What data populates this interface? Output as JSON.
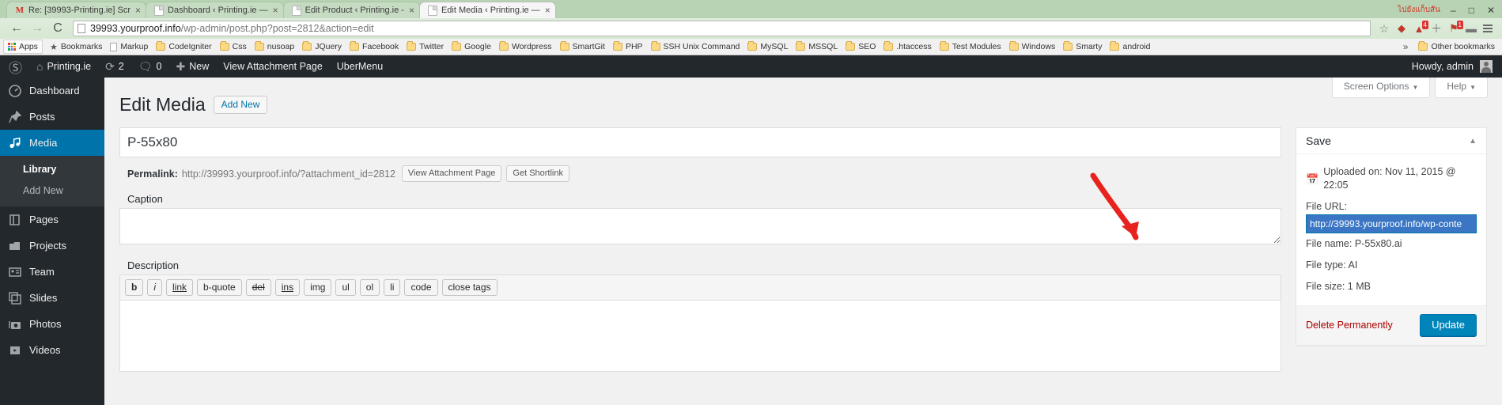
{
  "browser": {
    "tabs": [
      {
        "title": "Re: [39993-Printing.ie] Scr",
        "favicon": "gmail-icon",
        "active": false
      },
      {
        "title": "Dashboard ‹ Printing.ie —",
        "favicon": "page-icon",
        "active": false
      },
      {
        "title": "Edit Product ‹ Printing.ie -",
        "favicon": "page-icon",
        "active": false
      },
      {
        "title": "Edit Media ‹ Printing.ie —",
        "favicon": "page-icon",
        "active": true
      }
    ],
    "tab_close_label": "×",
    "titlebar_right_text": "ไปยังแก็บสัน",
    "window_controls": {
      "minimize": "–",
      "maximize": "□",
      "close": "✕"
    },
    "nav": {
      "back": "←",
      "forward": "→",
      "reload": "C"
    },
    "url": {
      "host": "39993.yourproof.info",
      "path": "/wp-admin/post.php?post=2812&action=edit"
    },
    "omnibox_icons": {
      "star": "☆",
      "page": "page-icon"
    },
    "toolbar_icons": [
      {
        "name": "extension-red-icon",
        "glyph": "◆",
        "badge": ""
      },
      {
        "name": "notification-badge-icon",
        "glyph": "▲",
        "badge": "4"
      },
      {
        "name": "add-extension-icon",
        "glyph": "＋",
        "badge": ""
      },
      {
        "name": "extension-alert-icon",
        "glyph": "⚑",
        "badge": "1"
      },
      {
        "name": "profile-icon",
        "glyph": "▬",
        "badge": ""
      }
    ],
    "bookmarks": [
      {
        "label": "Apps",
        "icon": "apps-grid-icon"
      },
      {
        "label": "Bookmarks",
        "icon": "star-icon"
      },
      {
        "label": "Markup",
        "icon": "doc-icon"
      },
      {
        "label": "CodeIgniter",
        "icon": "folder-icon"
      },
      {
        "label": "Css",
        "icon": "folder-icon"
      },
      {
        "label": "nusoap",
        "icon": "folder-icon"
      },
      {
        "label": "JQuery",
        "icon": "folder-icon"
      },
      {
        "label": "Facebook",
        "icon": "folder-icon"
      },
      {
        "label": "Twitter",
        "icon": "folder-icon"
      },
      {
        "label": "Google",
        "icon": "folder-icon"
      },
      {
        "label": "Wordpress",
        "icon": "folder-icon"
      },
      {
        "label": "SmartGit",
        "icon": "folder-icon"
      },
      {
        "label": "PHP",
        "icon": "folder-icon"
      },
      {
        "label": "SSH Unix Command",
        "icon": "folder-icon"
      },
      {
        "label": "MySQL",
        "icon": "folder-icon"
      },
      {
        "label": "MSSQL",
        "icon": "folder-icon"
      },
      {
        "label": "SEO",
        "icon": "folder-icon"
      },
      {
        "label": ".htaccess",
        "icon": "folder-icon"
      },
      {
        "label": "Test Modules",
        "icon": "folder-icon"
      },
      {
        "label": "Windows",
        "icon": "folder-icon"
      },
      {
        "label": "Smarty",
        "icon": "folder-icon"
      },
      {
        "label": "android",
        "icon": "folder-icon"
      }
    ],
    "bookmarks_overflow": "»",
    "other_bookmarks": "Other bookmarks"
  },
  "adminbar": {
    "logo": "wordpress-logo-icon",
    "site_name": "Printing.ie",
    "updates_count": "2",
    "comments_count": "0",
    "new_label": "New",
    "view_attachment_page": "View Attachment Page",
    "ubermenu": "UberMenu",
    "howdy": "Howdy, admin"
  },
  "sidebar": {
    "items": [
      {
        "label": "Dashboard",
        "icon": "dashboard-icon",
        "glyph": "◔",
        "current": false
      },
      {
        "label": "Posts",
        "icon": "pin-icon",
        "glyph": "✐",
        "current": false
      },
      {
        "label": "Media",
        "icon": "media-icon",
        "glyph": "♫",
        "current": true
      },
      {
        "label": "Pages",
        "icon": "pages-icon",
        "glyph": "◫",
        "current": false
      },
      {
        "label": "Projects",
        "icon": "projects-icon",
        "glyph": "▰",
        "current": false
      },
      {
        "label": "Team",
        "icon": "team-icon",
        "glyph": "▤",
        "current": false
      },
      {
        "label": "Slides",
        "icon": "slides-icon",
        "glyph": "❐",
        "current": false
      },
      {
        "label": "Photos",
        "icon": "photos-icon",
        "glyph": "❁",
        "current": false
      },
      {
        "label": "Videos",
        "icon": "videos-icon",
        "glyph": "▶",
        "current": false
      }
    ],
    "media_submenu": [
      {
        "label": "Library",
        "active": true
      },
      {
        "label": "Add New",
        "active": false
      }
    ]
  },
  "screen_meta": {
    "screen_options": "Screen Options",
    "help": "Help",
    "caret": "▼"
  },
  "main": {
    "page_title": "Edit Media",
    "add_new_button": "Add New",
    "title_field_value": "P-55x80",
    "permalink": {
      "label": "Permalink:",
      "url": "http://39993.yourproof.info/?attachment_id=2812",
      "view_attachment_page_button": "View Attachment Page",
      "get_shortlink_button": "Get Shortlink"
    },
    "caption_label": "Caption",
    "caption_value": "",
    "description_label": "Description",
    "editor_buttons": [
      "b",
      "i",
      "link",
      "b-quote",
      "del",
      "ins",
      "img",
      "ul",
      "ol",
      "li",
      "code",
      "close tags"
    ],
    "description_value": ""
  },
  "save_box": {
    "title": "Save",
    "collapse_toggle": "▲",
    "uploaded_on": "Uploaded on: Nov 11, 2015 @ 22:05",
    "calendar_icon": "calendar-icon",
    "file_url_label": "File URL:",
    "file_url_value": "http://39993.yourproof.info/wp-conte",
    "file_name": "File name: P-55x80.ai",
    "file_type": "File type: AI",
    "file_size": "File size: 1 MB",
    "delete_permanently": "Delete Permanently",
    "update_button": "Update"
  },
  "annotation": {
    "arrow_color": "#e8231e",
    "points_to": "file-url-input"
  },
  "colors": {
    "wp_admin_dark": "#23282d",
    "wp_blue": "#0073aa",
    "wp_button_blue": "#0085ba",
    "delete_red": "#a00000",
    "annotation_red": "#e8231e"
  }
}
